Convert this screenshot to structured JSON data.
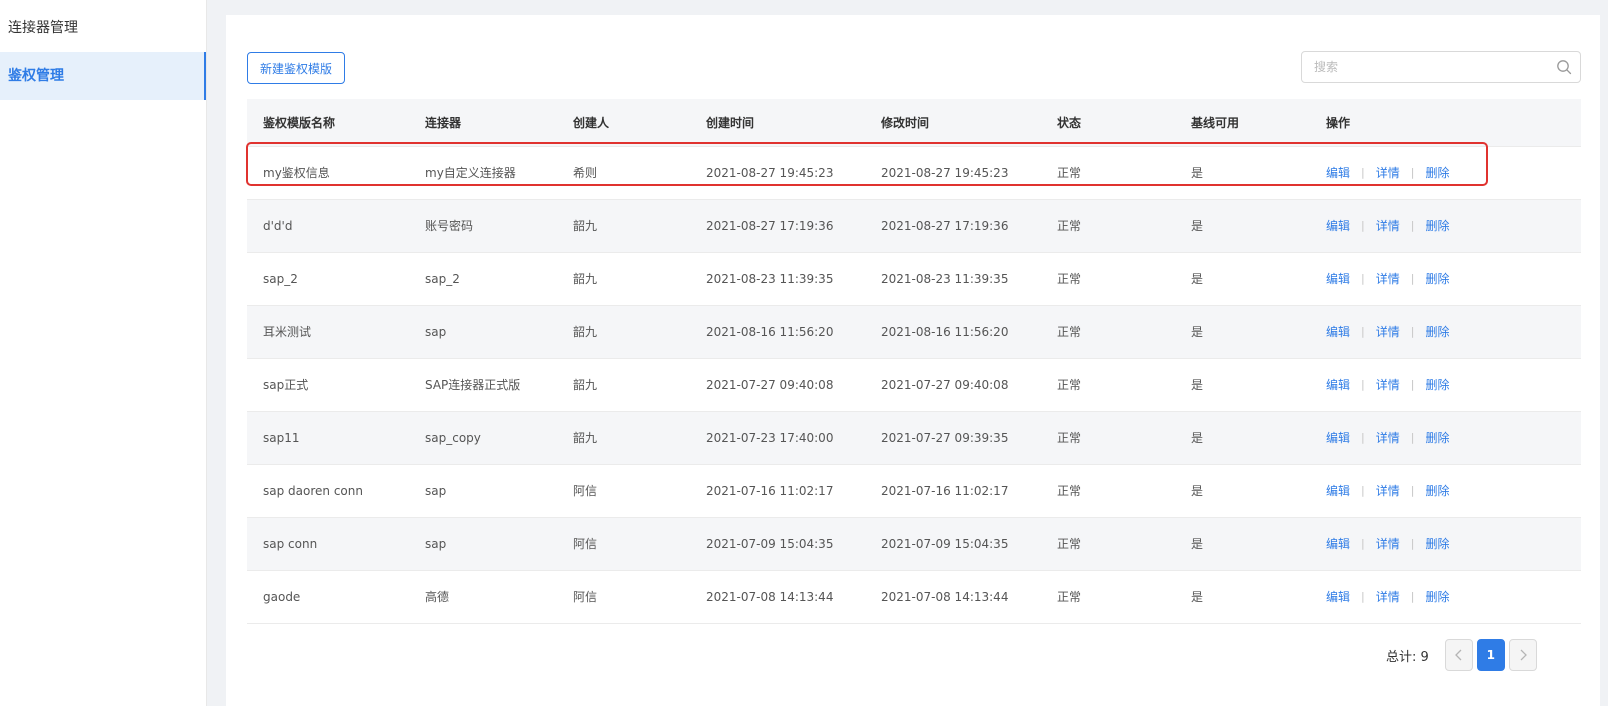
{
  "sidebar": {
    "items": [
      {
        "label": "连接器管理",
        "active": false
      },
      {
        "label": "鉴权管理",
        "active": true
      }
    ]
  },
  "toolbar": {
    "new_button": "新建鉴权模版",
    "search_placeholder": "搜索",
    "search_icon": "search-icon"
  },
  "table": {
    "headers": [
      "鉴权模版名称",
      "连接器",
      "创建人",
      "创建时间",
      "修改时间",
      "状态",
      "基线可用",
      "操作"
    ],
    "rows": [
      {
        "name": "my鉴权信息",
        "connector": "my自定义连接器",
        "creator": "希则",
        "created": "2021-08-27 19:45:23",
        "modified": "2021-08-27 19:45:23",
        "status": "正常",
        "baseline": "是"
      },
      {
        "name": "d'd'd",
        "connector": "账号密码",
        "creator": "韶九",
        "created": "2021-08-27 17:19:36",
        "modified": "2021-08-27 17:19:36",
        "status": "正常",
        "baseline": "是"
      },
      {
        "name": "sap_2",
        "connector": "sap_2",
        "creator": "韶九",
        "created": "2021-08-23 11:39:35",
        "modified": "2021-08-23 11:39:35",
        "status": "正常",
        "baseline": "是"
      },
      {
        "name": "耳米测试",
        "connector": "sap",
        "creator": "韶九",
        "created": "2021-08-16 11:56:20",
        "modified": "2021-08-16 11:56:20",
        "status": "正常",
        "baseline": "是"
      },
      {
        "name": "sap正式",
        "connector": "SAP连接器正式版",
        "creator": "韶九",
        "created": "2021-07-27 09:40:08",
        "modified": "2021-07-27 09:40:08",
        "status": "正常",
        "baseline": "是"
      },
      {
        "name": "sap11",
        "connector": "sap_copy",
        "creator": "韶九",
        "created": "2021-07-23 17:40:00",
        "modified": "2021-07-27 09:39:35",
        "status": "正常",
        "baseline": "是"
      },
      {
        "name": "sap daoren conn",
        "connector": "sap",
        "creator": "阿信",
        "created": "2021-07-16 11:02:17",
        "modified": "2021-07-16 11:02:17",
        "status": "正常",
        "baseline": "是"
      },
      {
        "name": "sap conn",
        "connector": "sap",
        "creator": "阿信",
        "created": "2021-07-09 15:04:35",
        "modified": "2021-07-09 15:04:35",
        "status": "正常",
        "baseline": "是"
      },
      {
        "name": "gaode",
        "connector": "高德",
        "creator": "阿信",
        "created": "2021-07-08 14:13:44",
        "modified": "2021-07-08 14:13:44",
        "status": "正常",
        "baseline": "是"
      }
    ],
    "actions": {
      "edit": "编辑",
      "detail": "详情",
      "delete": "删除",
      "separator": "|"
    }
  },
  "pagination": {
    "total_label": "总计: 9",
    "current_page": "1",
    "prev_icon": "chevron-left-icon",
    "next_icon": "chevron-right-icon"
  },
  "colors": {
    "accent": "#2f7ce6",
    "highlight_border": "#e0322f",
    "stripe": "#f5f6f8"
  }
}
